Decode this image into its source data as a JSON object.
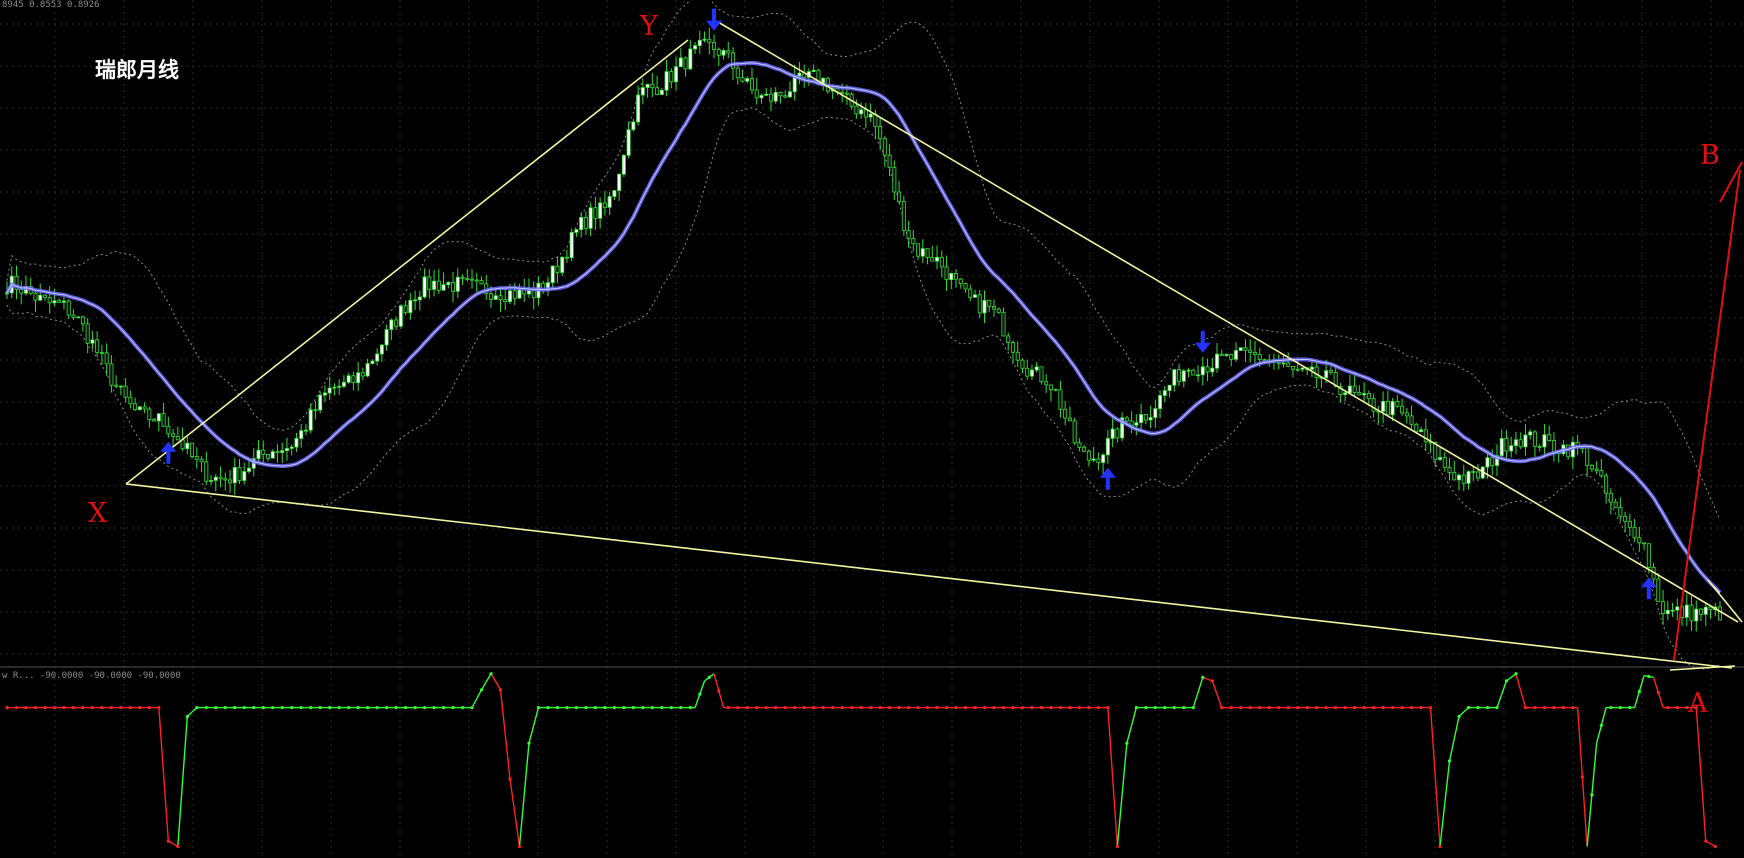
{
  "window": {
    "ohlc_readout": "8945 0.8553 0.8926",
    "indicator_readout": "w R... -90.0000 -90.0000 -90.0000"
  },
  "chart_data": {
    "type": "candlestick",
    "title": "瑞郎月线",
    "pattern_labels": [
      "X",
      "Y",
      "A",
      "B"
    ],
    "colors": {
      "background": "#000000",
      "grid": "#2c2c2c",
      "bull_candle": "#ffffff",
      "bear_candle": "#111111",
      "wick": "#33dd33",
      "ma_line": "#6b6bff",
      "band": "#8a8a8a",
      "trendline": "#f3f3a0",
      "projection": "#e01010",
      "signal_arrow": "#2233ff",
      "osc_up": "#33ff33",
      "osc_down": "#ff2222"
    },
    "candle_keypoints": [
      [
        0,
        0.95
      ],
      [
        10,
        0.93
      ],
      [
        30,
        0.82
      ],
      [
        45,
        0.76
      ],
      [
        58,
        0.79
      ],
      [
        70,
        0.85
      ],
      [
        90,
        0.95
      ],
      [
        110,
        0.94
      ],
      [
        125,
        1.02
      ],
      [
        135,
        1.14
      ],
      [
        148,
        1.18
      ],
      [
        160,
        1.13
      ],
      [
        170,
        1.15
      ],
      [
        180,
        1.12
      ],
      [
        193,
        0.98
      ],
      [
        205,
        0.93
      ],
      [
        218,
        0.86
      ],
      [
        228,
        0.78
      ],
      [
        238,
        0.82
      ],
      [
        250,
        0.87
      ],
      [
        262,
        0.88
      ],
      [
        275,
        0.86
      ],
      [
        290,
        0.83
      ],
      [
        308,
        0.76
      ],
      [
        318,
        0.8
      ],
      [
        330,
        0.79
      ],
      [
        343,
        0.71
      ],
      [
        350,
        0.63
      ]
    ],
    "signal_arrows": [
      {
        "index": 34,
        "dir": "up"
      },
      {
        "index": 149,
        "dir": "down"
      },
      {
        "index": 232,
        "dir": "up"
      },
      {
        "index": 252,
        "dir": "down"
      },
      {
        "index": 346,
        "dir": "up"
      }
    ],
    "oscillator": {
      "ylim": [
        -100,
        0
      ],
      "pivots": [
        [
          0,
          -20
        ],
        [
          32,
          -20
        ],
        [
          34,
          -95
        ],
        [
          36,
          -98
        ],
        [
          38,
          -25
        ],
        [
          40,
          -20
        ],
        [
          98,
          -20
        ],
        [
          100,
          -10
        ],
        [
          102,
          -1
        ],
        [
          104,
          -10
        ],
        [
          106,
          -60
        ],
        [
          108,
          -98
        ],
        [
          110,
          -40
        ],
        [
          112,
          -20
        ],
        [
          145,
          -20
        ],
        [
          147,
          -5
        ],
        [
          149,
          -1
        ],
        [
          151,
          -20
        ],
        [
          232,
          -20
        ],
        [
          234,
          -98
        ],
        [
          236,
          -40
        ],
        [
          238,
          -20
        ],
        [
          250,
          -20
        ],
        [
          252,
          -3
        ],
        [
          254,
          -5
        ],
        [
          256,
          -20
        ],
        [
          300,
          -20
        ],
        [
          302,
          -98
        ],
        [
          304,
          -50
        ],
        [
          306,
          -25
        ],
        [
          308,
          -20
        ],
        [
          314,
          -20
        ],
        [
          316,
          -5
        ],
        [
          318,
          -1
        ],
        [
          320,
          -20
        ],
        [
          331,
          -20
        ],
        [
          333,
          -98
        ],
        [
          335,
          -40
        ],
        [
          337,
          -20
        ],
        [
          343,
          -20
        ],
        [
          345,
          -2
        ],
        [
          347,
          -3
        ],
        [
          349,
          -20
        ],
        [
          356,
          -20
        ],
        [
          358,
          -95
        ],
        [
          360,
          -98
        ]
      ]
    }
  }
}
